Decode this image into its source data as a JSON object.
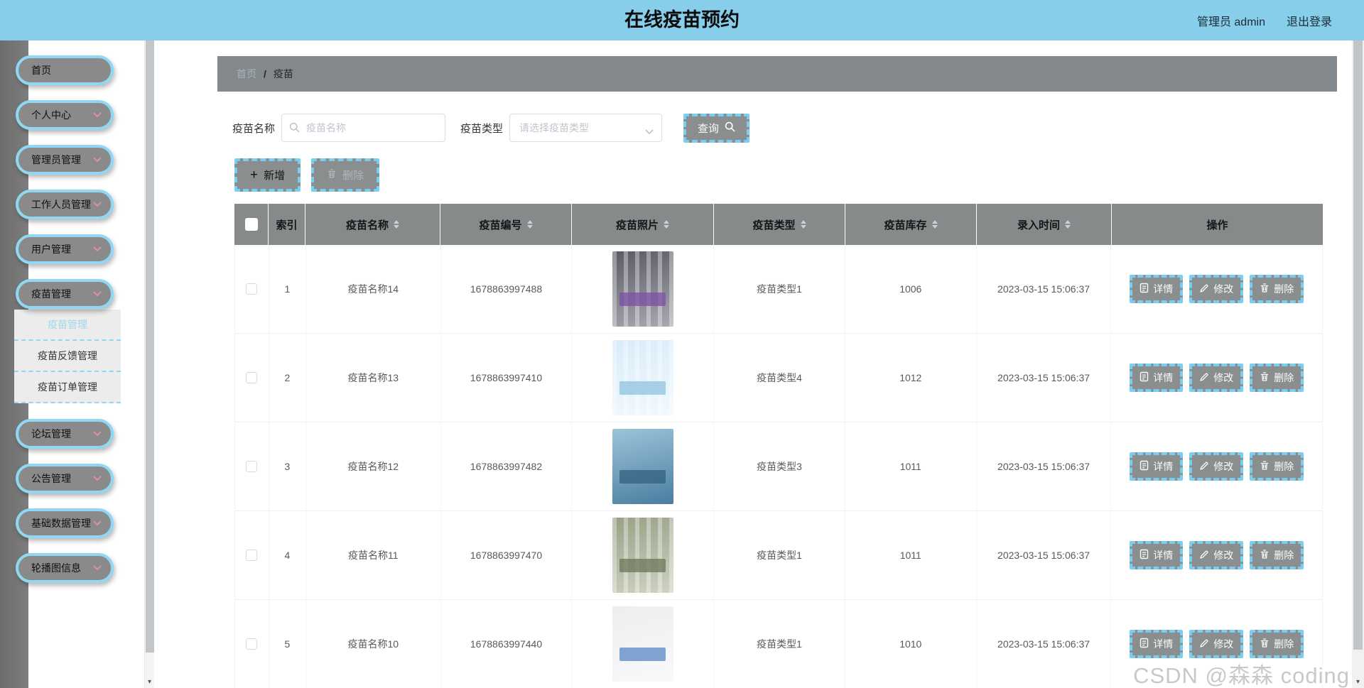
{
  "colors": {
    "theme_blue": "#87ceeb",
    "dash_blue": "#79cef1",
    "button_gray": "#8a8e8f",
    "table_head_gray": "#868a8b",
    "breadcrumb_gray": "#82888c",
    "sidebar_rail_gray": "#737373",
    "active_menu_blue": "#9fd8ee",
    "chevron_pink": "#e890a8"
  },
  "header": {
    "title": "在线疫苗预约",
    "user_label": "管理员 admin",
    "logout_label": "退出登录"
  },
  "sidebar": {
    "items": [
      {
        "label": "首页",
        "expandable": false
      },
      {
        "label": "个人中心",
        "expandable": true
      },
      {
        "label": "管理员管理",
        "expandable": true
      },
      {
        "label": "工作人员管理",
        "expandable": true
      },
      {
        "label": "用户管理",
        "expandable": true
      },
      {
        "label": "疫苗管理",
        "expandable": true,
        "expanded": true,
        "active_child_index": 0,
        "children": [
          "疫苗管理",
          "疫苗反馈管理",
          "疫苗订单管理"
        ]
      },
      {
        "label": "论坛管理",
        "expandable": true
      },
      {
        "label": "公告管理",
        "expandable": true
      },
      {
        "label": "基础数据管理",
        "expandable": true
      },
      {
        "label": "轮播图信息",
        "expandable": true
      }
    ]
  },
  "breadcrumb": {
    "home": "首页",
    "separator": "/",
    "current": "疫苗"
  },
  "search": {
    "name_label": "疫苗名称",
    "name_placeholder": "疫苗名称",
    "type_label": "疫苗类型",
    "type_placeholder": "请选择疫苗类型",
    "query_label": "查询"
  },
  "toolbar": {
    "add_label": "新增",
    "delete_label": "删除"
  },
  "table": {
    "columns": [
      {
        "label": "索引",
        "sortable": false
      },
      {
        "label": "疫苗名称",
        "sortable": true
      },
      {
        "label": "疫苗编号",
        "sortable": true
      },
      {
        "label": "疫苗照片",
        "sortable": true
      },
      {
        "label": "疫苗类型",
        "sortable": true
      },
      {
        "label": "疫苗库存",
        "sortable": true
      },
      {
        "label": "录入时间",
        "sortable": true
      },
      {
        "label": "操作",
        "sortable": false
      }
    ],
    "action_labels": {
      "detail": "详情",
      "edit": "修改",
      "delete": "删除"
    },
    "rows": [
      {
        "index": "1",
        "name": "疫苗名称14",
        "code": "1678863997488",
        "type": "疫苗类型1",
        "stock": "1006",
        "time": "2023-03-15 15:06:37",
        "photo": {
          "desc": "vaccine-vials-purple-labels",
          "base": [
            "#5a5a64",
            "#a9a9b2"
          ],
          "accent": "#7b4fa6",
          "stripes": true
        }
      },
      {
        "index": "2",
        "name": "疫苗名称13",
        "code": "1678863997410",
        "type": "疫苗类型4",
        "stock": "1012",
        "time": "2023-03-15 15:06:37",
        "photo": {
          "desc": "hand-with-vaccine-bottles-lightblue",
          "base": [
            "#d7ecf9",
            "#f2f9fe"
          ],
          "accent": "#8fc1e0",
          "stripes": true
        }
      },
      {
        "index": "3",
        "name": "疫苗名称12",
        "code": "1678863997482",
        "type": "疫苗类型3",
        "stock": "1011",
        "time": "2023-03-15 15:06:37",
        "photo": {
          "desc": "gloved-hand-syringe-blue",
          "base": [
            "#9cc4da",
            "#4a7da0"
          ],
          "accent": "#31617f",
          "stripes": false
        }
      },
      {
        "index": "4",
        "name": "疫苗名称11",
        "code": "1678863997470",
        "type": "疫苗类型1",
        "stock": "1011",
        "time": "2023-03-15 15:06:37",
        "photo": {
          "desc": "hands-holding-ampoule-green",
          "base": [
            "#98a186",
            "#cfd3c2"
          ],
          "accent": "#6a775a",
          "stripes": true
        }
      },
      {
        "index": "5",
        "name": "疫苗名称10",
        "code": "1678863997440",
        "type": "疫苗类型1",
        "stock": "1010",
        "time": "2023-03-15 15:06:37",
        "photo": {
          "desc": "nurse-white-coat-blue-gloves",
          "base": [
            "#eceef0",
            "#f8f9fa"
          ],
          "accent": "#5b87c5",
          "stripes": false
        }
      }
    ]
  },
  "watermark": "CSDN @森森 coding",
  "scrollbar": {
    "arrow": "▾"
  }
}
